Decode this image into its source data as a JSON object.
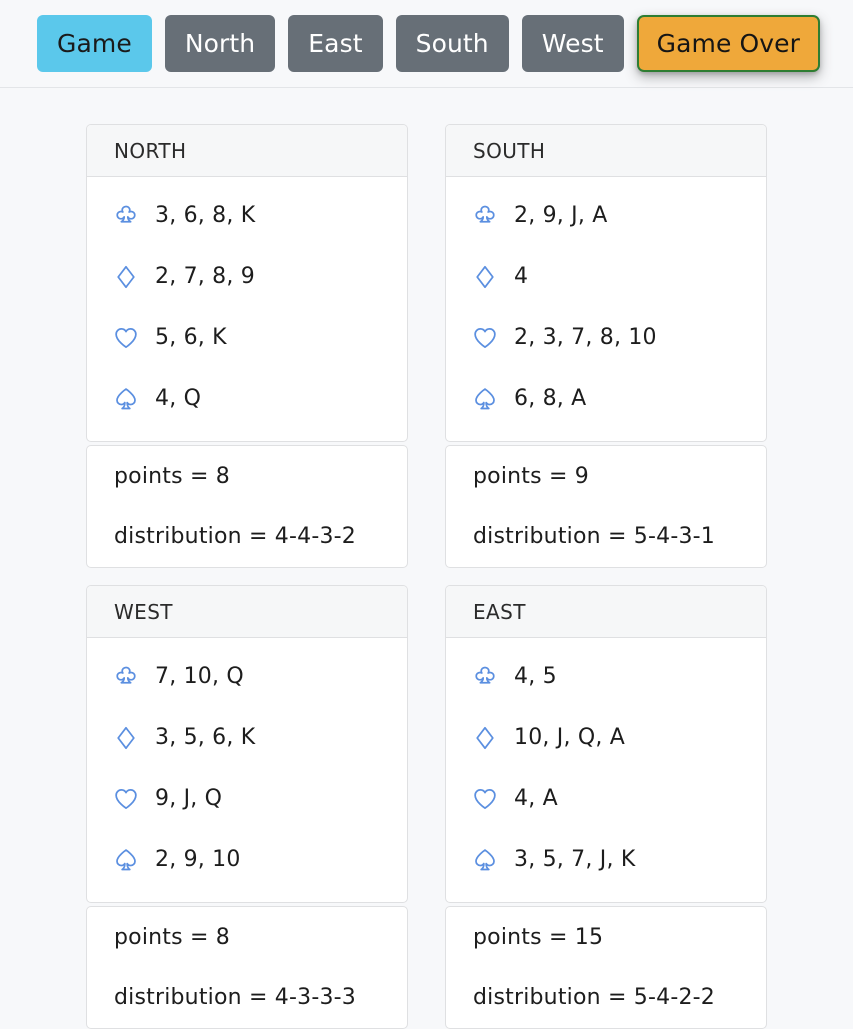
{
  "tabs": [
    {
      "label": "Game",
      "name": "tab-game",
      "style": "active"
    },
    {
      "label": "North",
      "name": "tab-north",
      "style": "plain"
    },
    {
      "label": "East",
      "name": "tab-east",
      "style": "plain"
    },
    {
      "label": "South",
      "name": "tab-south",
      "style": "plain"
    },
    {
      "label": "West",
      "name": "tab-west",
      "style": "plain"
    },
    {
      "label": "Game Over",
      "name": "tab-game-over",
      "style": "over"
    }
  ],
  "colors": {
    "tab_active_bg": "#5bc8eb",
    "tab_plain_bg": "#676f77",
    "game_over_bg": "#efa83a",
    "game_over_border": "#2e7d32",
    "suit_blue": "#5b8fe0",
    "page_bg": "#f7f8fa",
    "card_bg": "#ffffff",
    "card_border": "#dfe0e2",
    "card_header_bg": "#f6f7f8"
  },
  "labels": {
    "points_prefix": "points = ",
    "distribution_prefix": "distribution = "
  },
  "seats": [
    {
      "title": "NORTH",
      "suits": [
        {
          "suit": "clubs",
          "icon": "club-icon",
          "cards": "3, 6, 8, K"
        },
        {
          "suit": "diamonds",
          "icon": "diamond-icon",
          "cards": "2, 7, 8, 9"
        },
        {
          "suit": "hearts",
          "icon": "heart-icon",
          "cards": "5, 6, K"
        },
        {
          "suit": "spades",
          "icon": "spade-icon",
          "cards": "4, Q"
        }
      ],
      "points": "points = 8",
      "distribution": "distribution = 4-4-3-2"
    },
    {
      "title": "SOUTH",
      "suits": [
        {
          "suit": "clubs",
          "icon": "club-icon",
          "cards": "2, 9, J, A"
        },
        {
          "suit": "diamonds",
          "icon": "diamond-icon",
          "cards": "4"
        },
        {
          "suit": "hearts",
          "icon": "heart-icon",
          "cards": "2, 3, 7, 8, 10"
        },
        {
          "suit": "spades",
          "icon": "spade-icon",
          "cards": "6, 8, A"
        }
      ],
      "points": "points = 9",
      "distribution": "distribution = 5-4-3-1"
    },
    {
      "title": "WEST",
      "suits": [
        {
          "suit": "clubs",
          "icon": "club-icon",
          "cards": "7, 10, Q"
        },
        {
          "suit": "diamonds",
          "icon": "diamond-icon",
          "cards": "3, 5, 6, K"
        },
        {
          "suit": "hearts",
          "icon": "heart-icon",
          "cards": "9, J, Q"
        },
        {
          "suit": "spades",
          "icon": "spade-icon",
          "cards": "2, 9, 10"
        }
      ],
      "points": "points = 8",
      "distribution": "distribution = 4-3-3-3"
    },
    {
      "title": "EAST",
      "suits": [
        {
          "suit": "clubs",
          "icon": "club-icon",
          "cards": "4, 5"
        },
        {
          "suit": "diamonds",
          "icon": "diamond-icon",
          "cards": "10, J, Q, A"
        },
        {
          "suit": "hearts",
          "icon": "heart-icon",
          "cards": "4, A"
        },
        {
          "suit": "spades",
          "icon": "spade-icon",
          "cards": "3, 5, 7, J, K"
        }
      ],
      "points": "points = 15",
      "distribution": "distribution = 5-4-2-2"
    }
  ]
}
